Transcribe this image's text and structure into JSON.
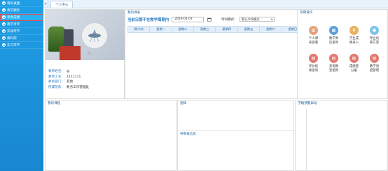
{
  "sidebar": {
    "items": [
      {
        "label": "我的桌面"
      },
      {
        "label": "教学服务"
      },
      {
        "label": "考务成绩"
      },
      {
        "label": "教学考评"
      },
      {
        "label": "实践环节"
      },
      {
        "label": "教科研"
      },
      {
        "label": "实习环节"
      }
    ]
  },
  "topbar": {
    "collapse_glyph": "«",
    "tab_label": "个人中心"
  },
  "profile": {
    "avatar_caption": "照片",
    "fields": [
      {
        "key": "教师姓名：",
        "value": "gj"
      },
      {
        "key": "教师工号：",
        "value": "1111111"
      },
      {
        "key": "教师部门：",
        "value": "其他"
      },
      {
        "key": "所属院系：",
        "value": "教务工作管理处"
      }
    ]
  },
  "schedule": {
    "panel_title": "我的课表",
    "heading": "当前日期不在教学周期内",
    "date": "2020-01-07",
    "mode_label": "时间模式：",
    "mode_value": "默认节次模式",
    "columns": [
      "周\\节次",
      "星期一",
      "星期二",
      "星期三",
      "星期四",
      "星期五",
      "星期六",
      "星期日"
    ]
  },
  "ops": {
    "panel_title": "常用操作",
    "items": [
      {
        "l1": "个人课",
        "l2": "表查看",
        "color": "#e2a27a",
        "icon": "building-icon"
      },
      {
        "l1": "教学周",
        "l2": "历查询",
        "color": "#5e9fd8",
        "icon": "calendar-icon"
      },
      {
        "l1": "学生成",
        "l2": "绩录入",
        "color": "#e9b25c",
        "icon": "graduate-icon"
      },
      {
        "l1": "专业培",
        "l2": "养方案",
        "color": "#7fc3e8",
        "icon": "bulb-icon"
      },
      {
        "l1": "评价结",
        "l2": "果查询",
        "color": "#e2786e",
        "icon": "clipboard-icon"
      },
      {
        "l1": "查询教",
        "l2": "室使用",
        "color": "#e2786e",
        "icon": "clipboard-icon"
      },
      {
        "l1": "成绩登",
        "l2": "分册",
        "color": "#e2786e",
        "icon": "clipboard-icon"
      },
      {
        "l1": "教学进",
        "l2": "度管理",
        "color": "#e2786e",
        "icon": "clipboard-icon"
      }
    ]
  },
  "bottom": {
    "my_course": "我的课程",
    "notice": "通知",
    "pending": "待审核信息",
    "warning": "学籍预警异动"
  }
}
